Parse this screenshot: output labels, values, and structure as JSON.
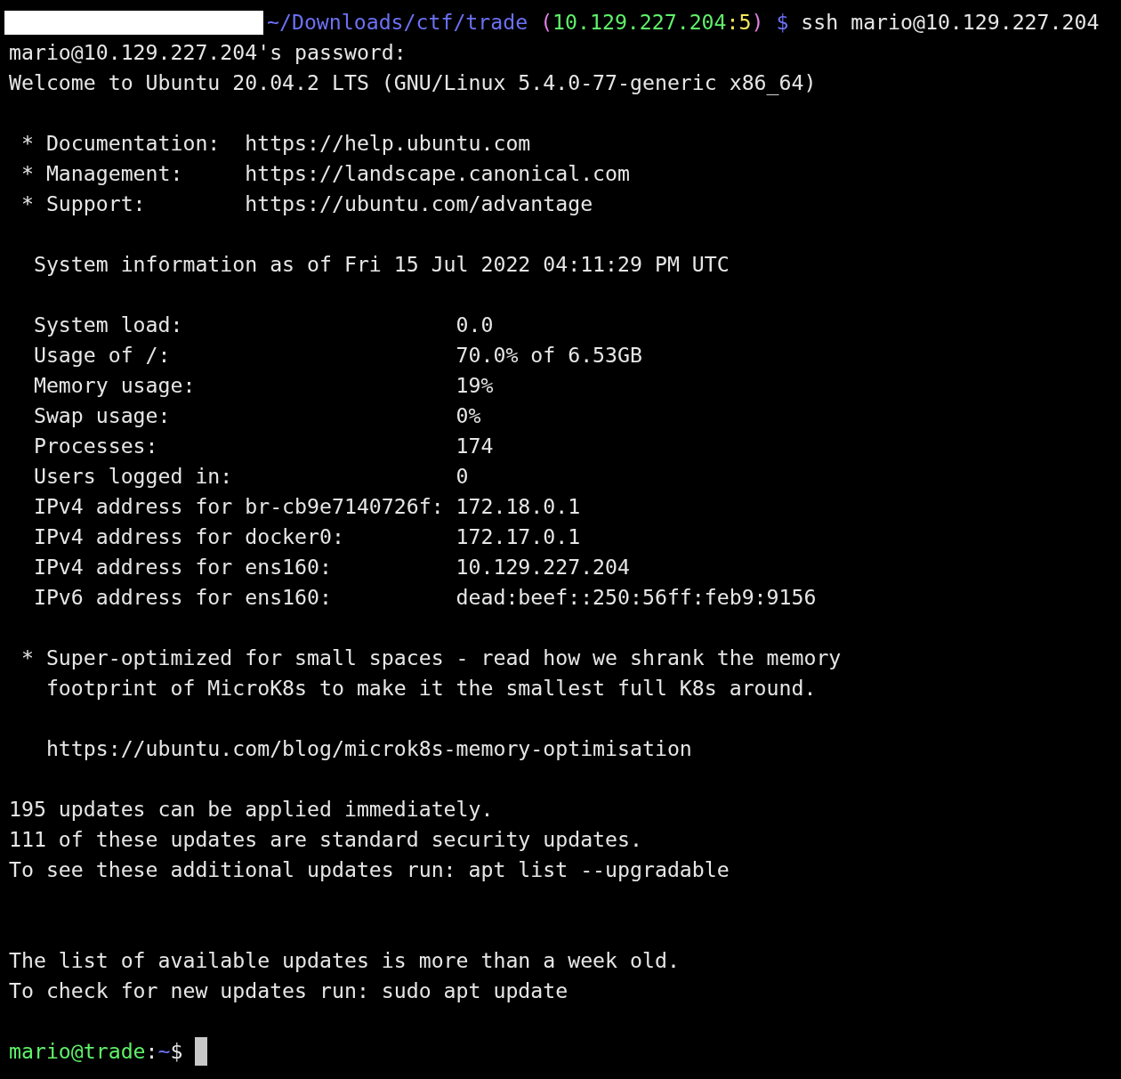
{
  "terminal": {
    "lines": [
      {
        "kind": "text",
        "segments": [
          {
            "kind": "redacted"
          },
          {
            "kind": "path",
            "text": "~/Downloads/ctf/trade"
          },
          {
            "kind": "paren",
            "text": " ("
          },
          {
            "kind": "host",
            "text": "10.129.227.204"
          },
          {
            "kind": "colon",
            "text": ":"
          },
          {
            "kind": "port",
            "text": "5"
          },
          {
            "kind": "paren",
            "text": ")"
          },
          {
            "kind": "dollar",
            "text": " $"
          },
          {
            "kind": "plain",
            "text": " ssh mario@10.129.227.204"
          }
        ]
      },
      {
        "kind": "text",
        "segments": [
          {
            "kind": "plain",
            "text": "mario@10.129.227.204's password:"
          }
        ]
      },
      {
        "kind": "text",
        "segments": [
          {
            "kind": "plain",
            "text": "Welcome to Ubuntu 20.04.2 LTS (GNU/Linux 5.4.0-77-generic x86_64)"
          }
        ]
      },
      {
        "kind": "blank"
      },
      {
        "kind": "text",
        "segments": [
          {
            "kind": "plain",
            "text": " * Documentation:  https://help.ubuntu.com"
          }
        ]
      },
      {
        "kind": "text",
        "segments": [
          {
            "kind": "plain",
            "text": " * Management:     https://landscape.canonical.com"
          }
        ]
      },
      {
        "kind": "text",
        "segments": [
          {
            "kind": "plain",
            "text": " * Support:        https://ubuntu.com/advantage"
          }
        ]
      },
      {
        "kind": "blank"
      },
      {
        "kind": "text",
        "segments": [
          {
            "kind": "plain",
            "text": "  System information as of Fri 15 Jul 2022 04:11:29 PM UTC"
          }
        ]
      },
      {
        "kind": "blank"
      },
      {
        "kind": "text",
        "segments": [
          {
            "kind": "plain",
            "text": "  System load:                      0.0"
          }
        ]
      },
      {
        "kind": "text",
        "segments": [
          {
            "kind": "plain",
            "text": "  Usage of /:                       70.0% of 6.53GB"
          }
        ]
      },
      {
        "kind": "text",
        "segments": [
          {
            "kind": "plain",
            "text": "  Memory usage:                     19%"
          }
        ]
      },
      {
        "kind": "text",
        "segments": [
          {
            "kind": "plain",
            "text": "  Swap usage:                       0%"
          }
        ]
      },
      {
        "kind": "text",
        "segments": [
          {
            "kind": "plain",
            "text": "  Processes:                        174"
          }
        ]
      },
      {
        "kind": "text",
        "segments": [
          {
            "kind": "plain",
            "text": "  Users logged in:                  0"
          }
        ]
      },
      {
        "kind": "text",
        "segments": [
          {
            "kind": "plain",
            "text": "  IPv4 address for br-cb9e7140726f: 172.18.0.1"
          }
        ]
      },
      {
        "kind": "text",
        "segments": [
          {
            "kind": "plain",
            "text": "  IPv4 address for docker0:         172.17.0.1"
          }
        ]
      },
      {
        "kind": "text",
        "segments": [
          {
            "kind": "plain",
            "text": "  IPv4 address for ens160:          10.129.227.204"
          }
        ]
      },
      {
        "kind": "text",
        "segments": [
          {
            "kind": "plain",
            "text": "  IPv6 address for ens160:          dead:beef::250:56ff:feb9:9156"
          }
        ]
      },
      {
        "kind": "blank"
      },
      {
        "kind": "text",
        "segments": [
          {
            "kind": "plain",
            "text": " * Super-optimized for small spaces - read how we shrank the memory"
          }
        ]
      },
      {
        "kind": "text",
        "segments": [
          {
            "kind": "plain",
            "text": "   footprint of MicroK8s to make it the smallest full K8s around."
          }
        ]
      },
      {
        "kind": "blank"
      },
      {
        "kind": "text",
        "segments": [
          {
            "kind": "plain",
            "text": "   https://ubuntu.com/blog/microk8s-memory-optimisation"
          }
        ]
      },
      {
        "kind": "blank"
      },
      {
        "kind": "text",
        "segments": [
          {
            "kind": "plain",
            "text": "195 updates can be applied immediately."
          }
        ]
      },
      {
        "kind": "text",
        "segments": [
          {
            "kind": "plain",
            "text": "111 of these updates are standard security updates."
          }
        ]
      },
      {
        "kind": "text",
        "segments": [
          {
            "kind": "plain",
            "text": "To see these additional updates run: apt list --upgradable"
          }
        ]
      },
      {
        "kind": "blank"
      },
      {
        "kind": "blank"
      },
      {
        "kind": "text",
        "segments": [
          {
            "kind": "plain",
            "text": "The list of available updates is more than a week old."
          }
        ]
      },
      {
        "kind": "text",
        "segments": [
          {
            "kind": "plain",
            "text": "To check for new updates run: sudo apt update"
          }
        ]
      },
      {
        "kind": "blank"
      },
      {
        "kind": "text",
        "segments": [
          {
            "kind": "user",
            "text": "mario@trade"
          },
          {
            "kind": "plain",
            "text": ":"
          },
          {
            "kind": "tilde",
            "text": "~"
          },
          {
            "kind": "plain",
            "text": "$ "
          },
          {
            "kind": "cursor"
          }
        ]
      }
    ]
  }
}
